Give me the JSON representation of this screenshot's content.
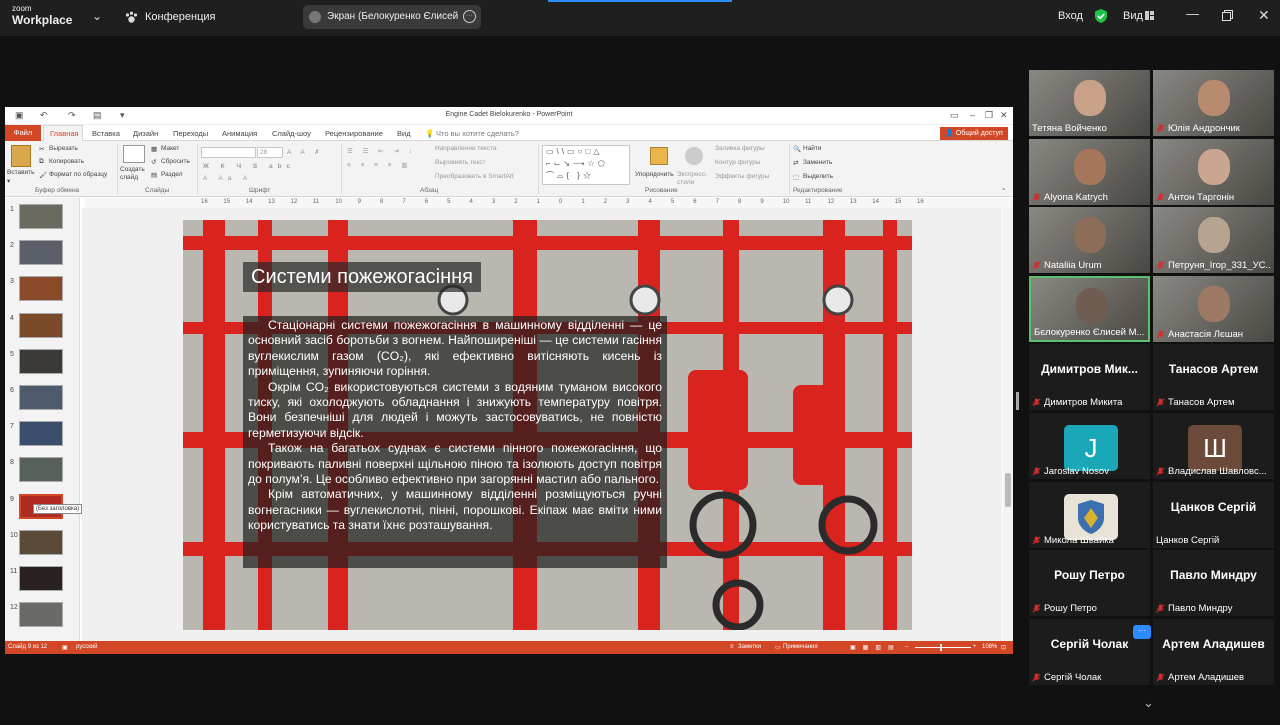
{
  "zoom": {
    "brand_top": "zoom",
    "brand_bottom": "Workplace",
    "meeting_label": "Конференция",
    "screen_share_label": "Экран (Белокуренко Єлисей Ми",
    "signin": "Вход",
    "view": "Вид",
    "colors": {
      "shield": "#1ec24a",
      "accent": "#2d8cff",
      "active_speaker": "#5ac26b"
    }
  },
  "ppt": {
    "title": "Engine Cadet Bielokurenko - PowerPoint",
    "tabs": [
      "Файл",
      "Главная",
      "Вставка",
      "Дизайн",
      "Переходы",
      "Анимация",
      "Слайд-шоу",
      "Рецензирование",
      "Вид"
    ],
    "tell_me": "Что вы хотите сделать?",
    "share": "Общий доступ",
    "ribbon": {
      "paste": "Вставить",
      "cut": "Вырезать",
      "copy": "Копировать",
      "format_painter": "Формат по образцу",
      "clipboard_group": "Буфер обмена",
      "new_slide": "Создать слайд",
      "layout": "Макет",
      "reset": "Сбросить",
      "section": "Раздел",
      "slides_group": "Слайды",
      "font_group": "Шрифт",
      "text_direction": "Направление текста",
      "align_text": "Выровнять текст",
      "smartart": "Преобразовать в SmartArt",
      "paragraph_group": "Абзац",
      "arrange": "Упорядочить",
      "quick_styles": "Экспресс-стили",
      "shape_fill": "Заливка фигуры",
      "shape_outline": "Контур фигуры",
      "shape_effects": "Эффекты фигуры",
      "drawing_group": "Рисование",
      "find": "Найти",
      "replace": "Заменить",
      "select": "Выделить",
      "editing_group": "Редактирование",
      "font_size": "28"
    },
    "ruler_ticks": [
      "16",
      "15",
      "14",
      "13",
      "12",
      "11",
      "10",
      "9",
      "8",
      "7",
      "6",
      "5",
      "4",
      "3",
      "2",
      "1",
      "0",
      "1",
      "2",
      "3",
      "4",
      "5",
      "6",
      "7",
      "8",
      "9",
      "10",
      "11",
      "12",
      "13",
      "14",
      "15",
      "16"
    ],
    "thumbnails": [
      "1",
      "2",
      "3",
      "4",
      "5",
      "6",
      "7",
      "8",
      "9",
      "10",
      "11",
      "12"
    ],
    "selected_slide_index": 8,
    "tooltip": "(Без заголовка)",
    "slide": {
      "title": "Системи пожежогасіння",
      "paragraphs": [
        "Стаціонарні системи пожежогасіння в машинному відділенні — це основний засіб боротьби з вогнем. Найпоширеніші — це системи гасіння вуглекислим газом (CO₂), які ефективно витісняють кисень із приміщення, зупиняючи горіння.",
        "Окрім CO₂ використовуються системи з водяним туманом високого тиску, які охолоджують обладнання і знижують температуру повітря. Вони безпечніші для людей і можуть застосовуватись, не повністю герметизуючи відсік.",
        "Також на багатьох суднах є системи пінного пожежогасіння, що покривають паливні поверхні щільною піною та ізолюють доступ повітря до полум’я. Це особливо ефективно при загорянні мастил або пального.",
        "Крім автоматичних, у машинному відділенні розміщуються ручні вогнегасники — вуглекислотні, пінні, порошкові. Екіпаж має вміти ними користуватись та знати їхнє розташування."
      ]
    },
    "status": {
      "slide_counter": "Слайд 9 из 12",
      "language": "русский",
      "notes": "Заметки",
      "comments": "Примечания",
      "zoom": "108%"
    }
  },
  "participants": [
    {
      "name": "Тетяна Войченко",
      "muted": false,
      "video": true
    },
    {
      "name": "Юлія Андрончик",
      "muted": true,
      "video": true
    },
    {
      "name": "Alyona Katrych",
      "muted": true,
      "video": true
    },
    {
      "name": "Антон Таргонін",
      "muted": true,
      "video": true
    },
    {
      "name": "Nataliia Urum",
      "muted": true,
      "video": true
    },
    {
      "name": "Петруня_Ігор_331_УС...",
      "muted": true,
      "video": true
    },
    {
      "name": "Бєлокуренко Єлисей М...",
      "muted": false,
      "video": true,
      "active": true
    },
    {
      "name": "Анастасія Лєшан",
      "muted": true,
      "video": true
    },
    {
      "name": "Димитров Микита",
      "muted": true,
      "big": "Димитров  Мик..."
    },
    {
      "name": "Танасов Артем",
      "muted": true,
      "big": "Танасов Артем"
    },
    {
      "name": "Jaroslav Nosov",
      "muted": true,
      "avatar": "J",
      "avatar_color": "#1aa8b8"
    },
    {
      "name": "Владислав Шавловс...",
      "muted": true,
      "avatar": "Ш",
      "avatar_color": "#6b4a3a"
    },
    {
      "name": "Микола Швайка",
      "muted": true,
      "avatar_img": "coat-of-arms"
    },
    {
      "name": "Цанков Сергій",
      "muted": false,
      "big": "Цанков Сергій"
    },
    {
      "name": "Рошу Петро",
      "muted": true,
      "big": "Рошу Петро"
    },
    {
      "name": "Павло Миндру",
      "muted": true,
      "big": "Павло Миндру"
    },
    {
      "name": "Сергій Чолак",
      "muted": true,
      "big": "Сергій Чолак"
    },
    {
      "name": "Артем Аладишев",
      "muted": true,
      "big": "Артем Аладишев"
    }
  ],
  "more_badge": "···"
}
